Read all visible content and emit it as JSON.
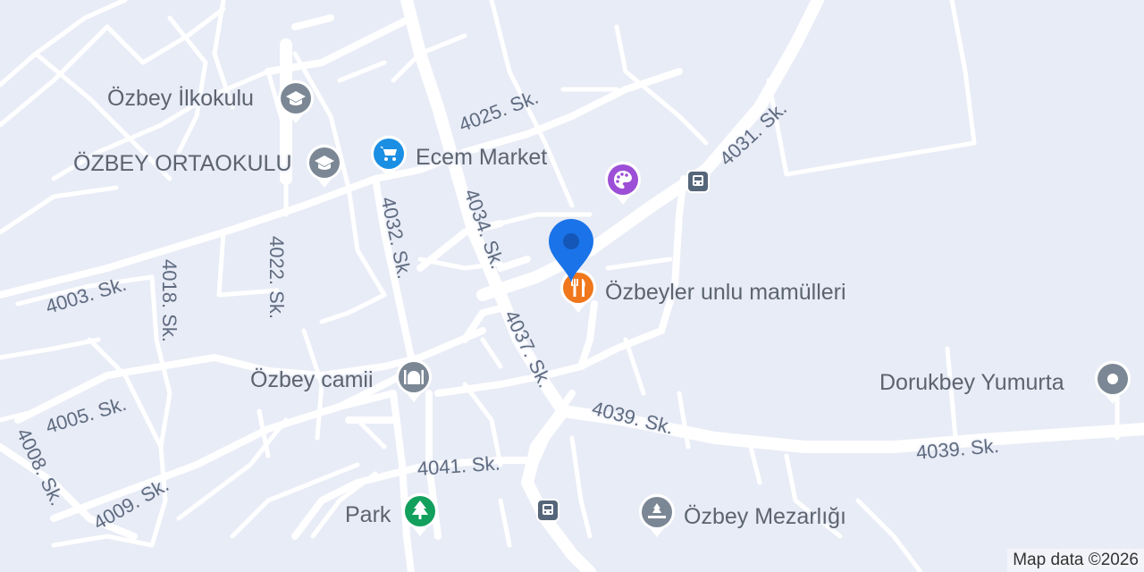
{
  "streets": [
    "4025. Sk.",
    "4031. Sk.",
    "4003. Sk.",
    "4032. Sk.",
    "4034. Sk.",
    "4022. Sk.",
    "4018. Sk.",
    "4037. Sk.",
    "4005. Sk.",
    "4039. Sk.",
    "4039. Sk.",
    "4008. Sk.",
    "4009. Sk.",
    "4041. Sk."
  ],
  "pois": {
    "school1": {
      "label": "Özbey İlkokulu",
      "icon": "school-icon",
      "color": "#7b8794"
    },
    "school2": {
      "label": "ÖZBEY ORTAOKULU",
      "icon": "school-icon",
      "color": "#7b8794"
    },
    "market": {
      "label": "Ecem Market",
      "icon": "shopping-cart-icon",
      "color": "#1a8fe3"
    },
    "art": {
      "label": "",
      "icon": "palette-icon",
      "color": "#9c4fd6"
    },
    "bakery": {
      "label": "Özbeyler unlu mamülleri",
      "icon": "restaurant-icon",
      "color": "#f0771b"
    },
    "mosque": {
      "label": "Özbey camii",
      "icon": "mosque-icon",
      "color": "#7b8794"
    },
    "egg": {
      "label": "Dorukbey Yumurta",
      "icon": "place-icon",
      "color": "#7b8794"
    },
    "park": {
      "label": "Park",
      "icon": "tree-icon",
      "color": "#12a05c"
    },
    "cemetery": {
      "label": "Özbey Mezarlığı",
      "icon": "cemetery-icon",
      "color": "#7b8794"
    }
  },
  "location_pin_color": "#1a73e8",
  "attribution": "Map data ©2026"
}
